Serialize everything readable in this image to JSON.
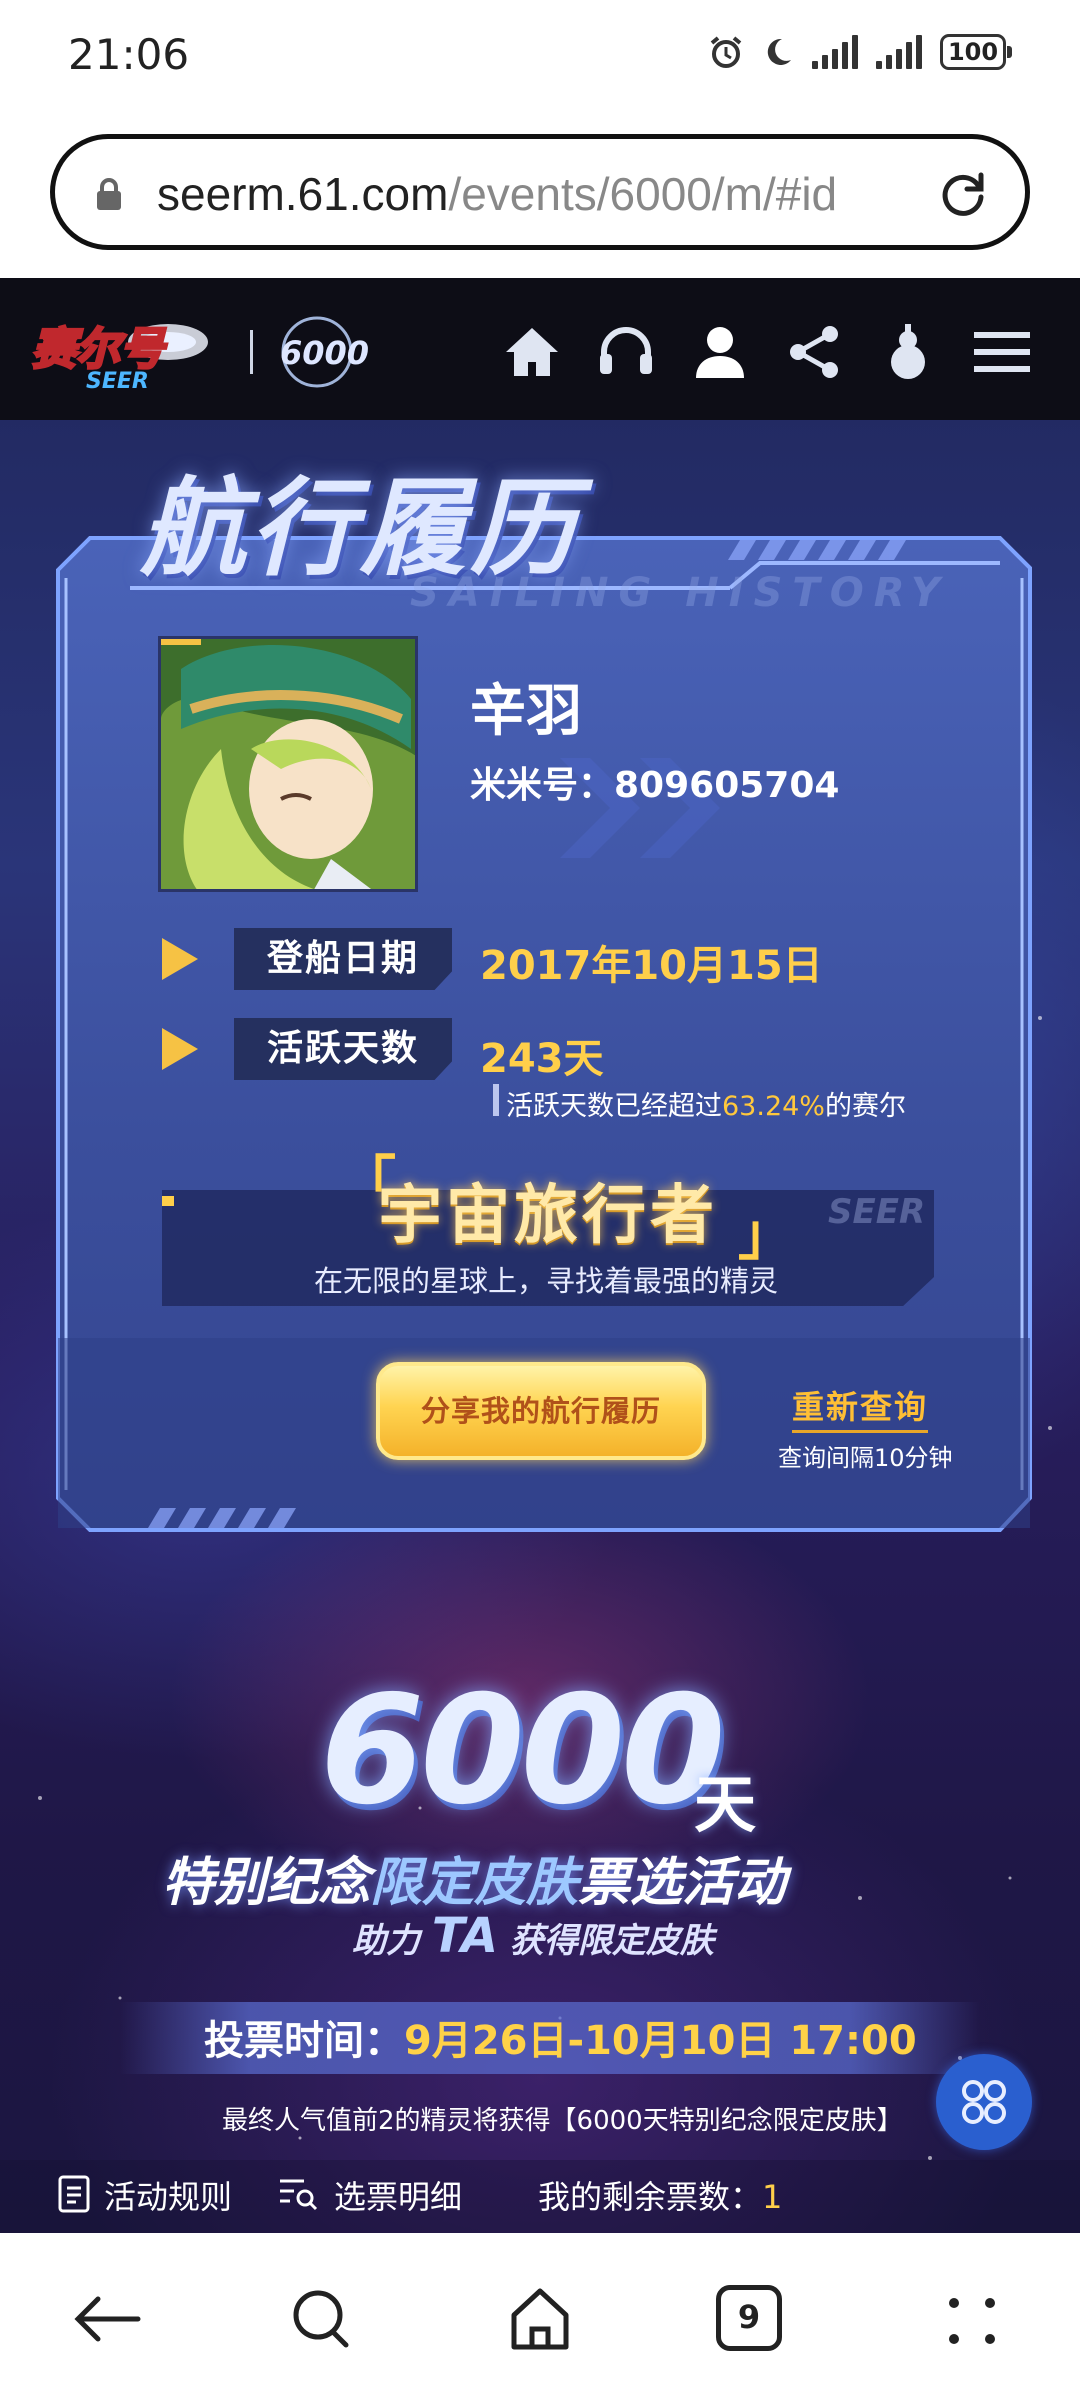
{
  "status_bar": {
    "time": "21:06",
    "battery": "100"
  },
  "address_bar": {
    "url_host": "seerm.61.com",
    "url_path": "/events/6000/m/#id"
  },
  "site_header": {
    "nav_icons": [
      "home-icon",
      "headset-icon",
      "user-icon",
      "share-icon",
      "gourd-icon",
      "menu-icon"
    ]
  },
  "profile_card": {
    "title": "航行履历",
    "subtitle_watermark": "SAILING HISTORY",
    "user_name": "辛羽",
    "user_id": "米米号：809605704",
    "board_date_label": "登船日期",
    "board_date_value": "2017年10月15日",
    "active_days_label": "活跃天数",
    "active_days_value": "243天",
    "note_prefix": "活跃天数已经超过",
    "note_percent": "63.24%",
    "note_suffix": "的赛尔",
    "seer_watermark": "SEER",
    "player_title": "宇宙旅行者",
    "player_title_desc": "在无限的星球上，寻找着最强的精灵",
    "share_button": "分享我的航行履历",
    "requery_button": "重新查询",
    "requery_interval": "查询间隔10分钟"
  },
  "campaign": {
    "big_number": "6000",
    "day_unit": "天",
    "title_part1": "特别纪念",
    "title_part2": "限定皮肤",
    "title_part3": "票选活动",
    "sub_part1": "助力",
    "sub_ta": "TA",
    "sub_part2": "获得限定皮肤",
    "vote_label": "投票时间：",
    "vote_time": "9月26日-10月10日 17:00",
    "prize_note": "最终人气值前2的精灵将获得【6000天特别纪念限定皮肤】"
  },
  "bottom_strip": {
    "rules": "活动规则",
    "vote_detail": "选票明细",
    "remaining_label": "我的剩余票数：",
    "remaining_value": "1"
  },
  "browser_nav": {
    "tab_count": "9"
  },
  "colors": {
    "gold": "#ffcf4a",
    "card_blue": "#3a4fa0",
    "float_button": "#2a5fcf"
  }
}
